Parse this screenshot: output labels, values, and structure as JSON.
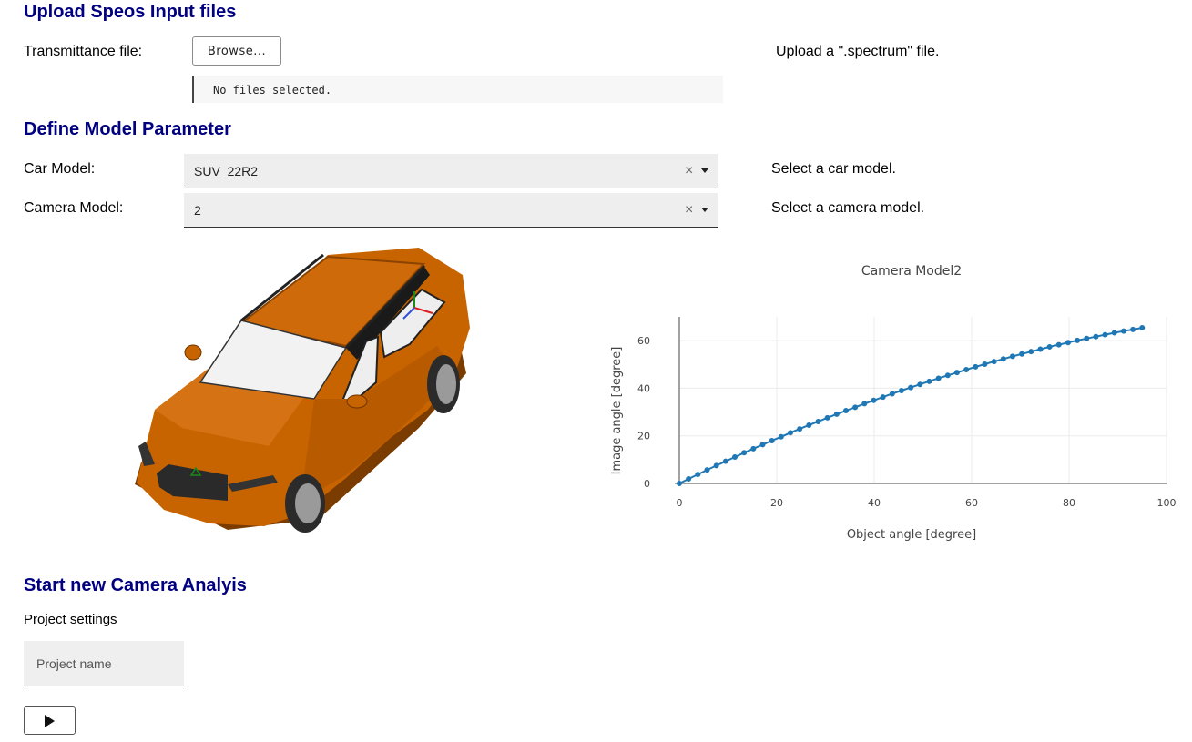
{
  "upload": {
    "heading": "Upload Speos Input files",
    "transmittance_label": "Transmittance file:",
    "browse_label": "Browse...",
    "file_status": "No files selected.",
    "hint": "Upload a \".spectrum\" file."
  },
  "model": {
    "heading": "Define Model Parameter",
    "car_label": "Car Model:",
    "car_value": "SUV_22R2",
    "car_hint": "Select a car model.",
    "camera_label": "Camera Model:",
    "camera_value": "2",
    "camera_hint": "Select a camera model.",
    "clear_glyph": "×",
    "car_color": "#c86400"
  },
  "analysis": {
    "heading": "Start new Camera Analyis",
    "settings_label": "Project settings",
    "project_placeholder": "Project name"
  },
  "chart_data": {
    "type": "line",
    "title": "Camera Model2",
    "xlabel": "Object angle [degree]",
    "ylabel": "Image angle [degree]",
    "xlim": [
      0,
      100
    ],
    "ylim": [
      0,
      70
    ],
    "xticks": [
      0,
      20,
      40,
      60,
      80,
      100
    ],
    "yticks": [
      0,
      20,
      40,
      60
    ],
    "grid": true,
    "marker": true,
    "color": "#1f77b4",
    "x": [
      0,
      1.9,
      3.8,
      5.7,
      7.6,
      9.5,
      11.4,
      13.3,
      15.2,
      17.1,
      19,
      20.9,
      22.8,
      24.7,
      26.6,
      28.5,
      30.4,
      32.3,
      34.2,
      36.1,
      38,
      39.9,
      41.8,
      43.7,
      45.6,
      47.5,
      49.4,
      51.3,
      53.2,
      55.1,
      57,
      58.9,
      60.8,
      62.7,
      64.6,
      66.5,
      68.4,
      70.3,
      72.2,
      74.1,
      76,
      77.9,
      79.8,
      81.7,
      83.6,
      85.5,
      87.4,
      89.3,
      91.2,
      93.1,
      95
    ],
    "y": [
      0,
      1.9,
      3.8,
      5.7,
      7.5,
      9.3,
      11.1,
      12.9,
      14.6,
      16.3,
      18,
      19.6,
      21.3,
      22.9,
      24.5,
      26,
      27.6,
      29.1,
      30.6,
      32,
      33.5,
      34.9,
      36.3,
      37.7,
      39,
      40.3,
      41.6,
      42.9,
      44.2,
      45.4,
      46.6,
      47.8,
      49,
      50.1,
      51.2,
      52.3,
      53.4,
      54.4,
      55.4,
      56.4,
      57.4,
      58.3,
      59.2,
      60.1,
      60.9,
      61.7,
      62.5,
      63.3,
      64,
      64.7,
      65.4
    ]
  }
}
